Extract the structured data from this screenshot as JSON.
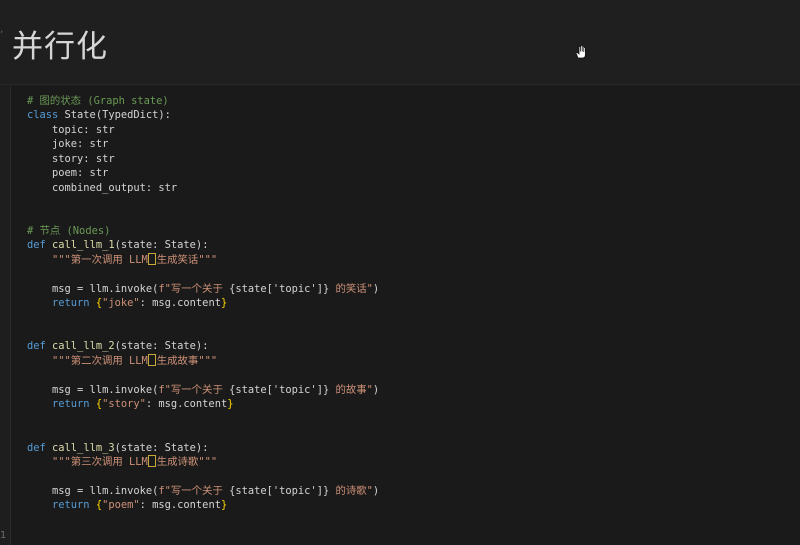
{
  "header": {
    "title": "并行化"
  },
  "code": {
    "l1_comment": "# 图的状态 (Graph state)",
    "l2_kw": "class",
    "l2_rest": " State(TypedDict):",
    "l3": "    topic: str",
    "l4": "    joke: str",
    "l5": "    story: str",
    "l6": "    poem: str",
    "l7": "    combined_output: str",
    "l10_comment": "# 节点 (Nodes)",
    "d1_kw": "def",
    "d1_name": " call_llm_1",
    "d1_sig": "(state: State):",
    "d1_doc_a": "    \"\"\"第一次调用 LLM",
    "d1_doc_b": "生成笑话\"\"\"",
    "d1_msg_a": "    msg = llm.invoke(",
    "d1_msg_f": "f\"写一个关于 ",
    "d1_msg_expr": "{state['topic']}",
    "d1_msg_end": " 的笑话\"",
    "d1_msg_close": ")",
    "d1_ret_kw": "    return",
    "d1_ret_key": "\"joke\"",
    "d1_ret_val": ": msg.content",
    "d2_kw": "def",
    "d2_name": " call_llm_2",
    "d2_sig": "(state: State):",
    "d2_doc_a": "    \"\"\"第二次调用 LLM",
    "d2_doc_b": "生成故事\"\"\"",
    "d2_msg_a": "    msg = llm.invoke(",
    "d2_msg_f": "f\"写一个关于 ",
    "d2_msg_expr": "{state['topic']}",
    "d2_msg_end": " 的故事\"",
    "d2_msg_close": ")",
    "d2_ret_kw": "    return",
    "d2_ret_key": "\"story\"",
    "d2_ret_val": ": msg.content",
    "d3_kw": "def",
    "d3_name": " call_llm_3",
    "d3_sig": "(state: State):",
    "d3_doc_a": "    \"\"\"第三次调用 LLM",
    "d3_doc_b": "生成诗歌\"\"\"",
    "d3_msg_a": "    msg = llm.invoke(",
    "d3_msg_f": "f\"写一个关于 ",
    "d3_msg_expr": "{state['topic']}",
    "d3_msg_end": " 的诗歌\"",
    "d3_msg_close": ")",
    "d3_ret_kw": "    return",
    "d3_ret_key": "\"poem\"",
    "d3_ret_val": ": msg.content",
    "brace_open": " {",
    "brace_close": "}"
  },
  "gutter_mark": "1",
  "colors": {
    "comment": "#6a9955",
    "keyword": "#569cd6",
    "string": "#ce9178",
    "function": "#dcdcaa",
    "brace": "#ffd700"
  }
}
